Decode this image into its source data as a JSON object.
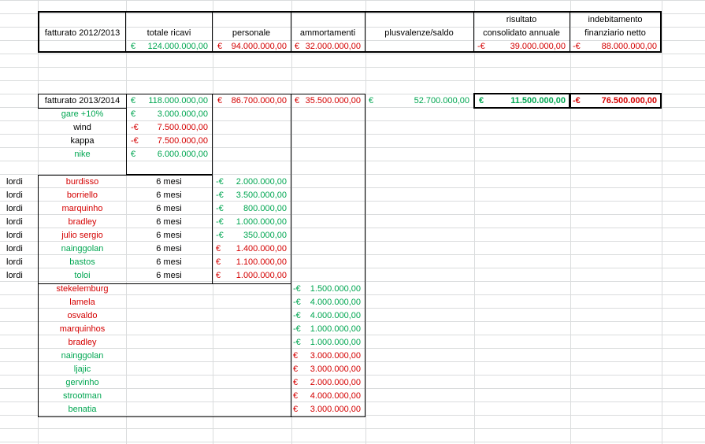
{
  "header": {
    "fatturato": "fatturato 2012/2013",
    "totale": "totale ricavi",
    "personale": "personale",
    "ammortamenti": "ammortamenti",
    "plusvalenze": "plusvalenze/saldo",
    "risultato_1": "risultato",
    "risultato_2": "consolidato annuale",
    "indebitamento_1": "indebitamento",
    "indebitamento_2": "finanziario netto"
  },
  "row2012": {
    "totale_sym": "€",
    "totale_val": "124.000.000,00",
    "personale_sym": "€",
    "personale_val": "94.000.000,00",
    "ammort_sym": "€",
    "ammort_val": "32.000.000,00",
    "risultato_sym": "-€",
    "risultato_val": "39.000.000,00",
    "indeb_sym": "-€",
    "indeb_val": "88.000.000,00"
  },
  "row2013": {
    "label": "fatturato 2013/2014",
    "totale_sym": "€",
    "totale_val": "118.000.000,00",
    "personale_sym": "€",
    "personale_val": "86.700.000,00",
    "ammort_sym": "€",
    "ammort_val": "35.500.000,00",
    "plus_sym": "€",
    "plus_val": "52.700.000,00",
    "risultato_sym": "€",
    "risultato_val": "11.500.000,00",
    "indeb_sym": "-€",
    "indeb_val": "76.500.000,00"
  },
  "ricavi": [
    {
      "label": "gare +10%",
      "sym": "€",
      "val": "3.000.000,00",
      "color": "green"
    },
    {
      "label": "wind",
      "sym": "-€",
      "val": "7.500.000,00",
      "color": "red"
    },
    {
      "label": "kappa",
      "sym": "-€",
      "val": "7.500.000,00",
      "color": "red"
    },
    {
      "label": "nike",
      "sym": "€",
      "val": "6.000.000,00",
      "color": "green"
    }
  ],
  "personale": [
    {
      "lordi": "lordi",
      "name": "burdisso",
      "mesi": "6 mesi",
      "sym": "-€",
      "val": "2.000.000,00",
      "color": "green"
    },
    {
      "lordi": "lordi",
      "name": "borriello",
      "mesi": "6 mesi",
      "sym": "-€",
      "val": "3.500.000,00",
      "color": "green"
    },
    {
      "lordi": "lordi",
      "name": "marquinho",
      "mesi": "6 mesi",
      "sym": "-€",
      "val": "800.000,00",
      "color": "green"
    },
    {
      "lordi": "lordi",
      "name": "bradley",
      "mesi": "6 mesi",
      "sym": "-€",
      "val": "1.000.000,00",
      "color": "green"
    },
    {
      "lordi": "lordi",
      "name": "julio sergio",
      "mesi": "6 mesi",
      "sym": "-€",
      "val": "350.000,00",
      "color": "green"
    },
    {
      "lordi": "lordi",
      "name": "nainggolan",
      "mesi": "6 mesi",
      "sym": "€",
      "val": "1.400.000,00",
      "color": "red"
    },
    {
      "lordi": "lordi",
      "name": "bastos",
      "mesi": "6 mesi",
      "sym": "€",
      "val": "1.100.000,00",
      "color": "red"
    },
    {
      "lordi": "lordi",
      "name": "toloi",
      "mesi": "6 mesi",
      "sym": "€",
      "val": "1.000.000,00",
      "color": "red"
    }
  ],
  "ammortamenti": [
    {
      "name": "stekelemburg",
      "sym": "-€",
      "val": "1.500.000,00",
      "color": "green"
    },
    {
      "name": "lamela",
      "sym": "-€",
      "val": "4.000.000,00",
      "color": "green"
    },
    {
      "name": "osvaldo",
      "sym": "-€",
      "val": "4.000.000,00",
      "color": "green"
    },
    {
      "name": "marquinhos",
      "sym": "-€",
      "val": "1.000.000,00",
      "color": "green"
    },
    {
      "name": "bradley",
      "sym": "-€",
      "val": "1.000.000,00",
      "color": "green"
    },
    {
      "name": "nainggolan",
      "sym": "€",
      "val": "3.000.000,00",
      "color": "red"
    },
    {
      "name": "ljajic",
      "sym": "€",
      "val": "3.000.000,00",
      "color": "red"
    },
    {
      "name": "gervinho",
      "sym": "€",
      "val": "2.000.000,00",
      "color": "red"
    },
    {
      "name": "strootman",
      "sym": "€",
      "val": "4.000.000,00",
      "color": "red"
    },
    {
      "name": "benatia",
      "sym": "€",
      "val": "3.000.000,00",
      "color": "red"
    }
  ],
  "name_colors": {
    "ricavi": [
      "green",
      "black",
      "black",
      "green"
    ],
    "personale": [
      "red",
      "red",
      "red",
      "red",
      "red",
      "green",
      "green",
      "green"
    ],
    "ammortamenti": [
      "red",
      "red",
      "red",
      "red",
      "red",
      "green",
      "green",
      "green",
      "green",
      "green"
    ]
  },
  "colors": {
    "green": "#00a651",
    "red": "#d40000",
    "grid": "#dadcdd"
  }
}
